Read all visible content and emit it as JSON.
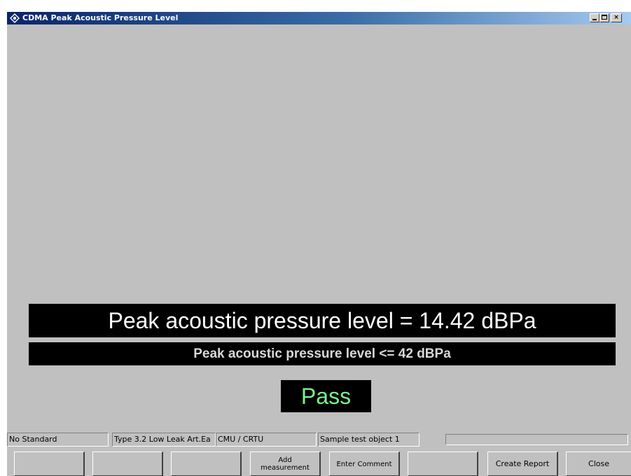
{
  "window": {
    "title": "CDMA Peak Acoustic Pressure Level",
    "icon": "rohde-schwarz-logo-icon"
  },
  "controls": {
    "minimize": "minimize-icon",
    "maximize": "maximize-icon",
    "close": "×"
  },
  "result": {
    "measurement_text": "Peak acoustic pressure level = 14.42 dBPa",
    "limit_text": "Peak acoustic pressure level <= 42 dBPa",
    "verdict": "Pass"
  },
  "colors": {
    "window_background": "#c0c0c0",
    "result_background": "#000000",
    "result_text": "#ffffff",
    "verdict_text": "#7cf08c",
    "titlebar_start": "#0a246a",
    "titlebar_end": "#a6caf0"
  },
  "status_bar": {
    "standard": "No Standard",
    "artificial_ear": "Type 3.2 Low Leak Art.Ea",
    "tester": "CMU / CRTU",
    "test_object": "Sample test object 1",
    "progress": 0
  },
  "buttons": {
    "button_1": "",
    "button_2": "",
    "button_3": "",
    "add_measurement": "Add measurement",
    "enter_comment": "Enter Comment",
    "button_6": "",
    "create_report": "Create Report",
    "close": "Close"
  }
}
